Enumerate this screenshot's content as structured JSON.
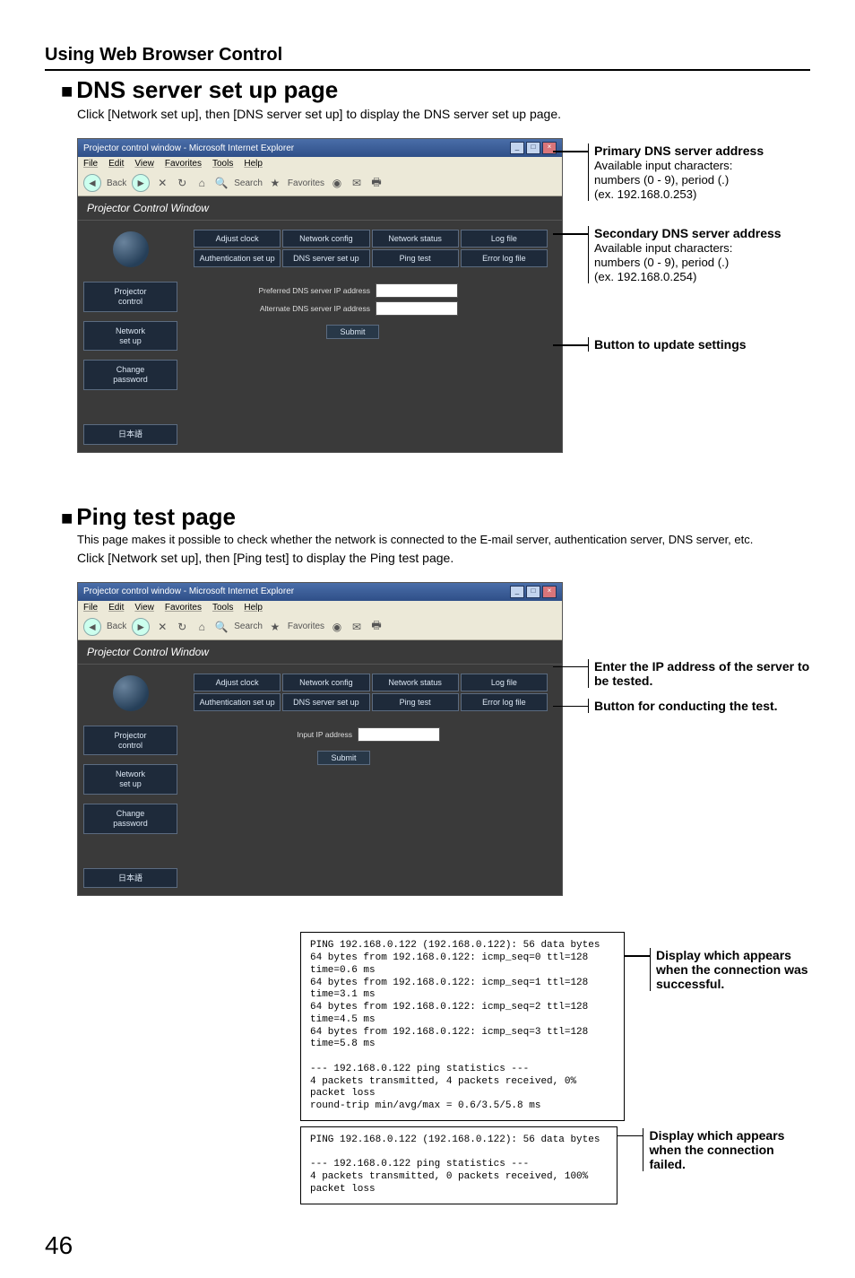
{
  "page_number": "46",
  "section_header": "Using Web Browser Control",
  "dns": {
    "heading_bullet": "■",
    "heading": "DNS server set up page",
    "desc": "Click [Network set up], then [DNS server set up] to display the DNS server set up page.",
    "browser_title": "Projector control window - Microsoft Internet Explorer",
    "menubar": {
      "file": "File",
      "edit": "Edit",
      "view": "View",
      "favorites": "Favorites",
      "tools": "Tools",
      "help": "Help"
    },
    "toolbar": {
      "back": "Back",
      "search": "Search",
      "favorites": "Favorites"
    },
    "pcw_title": "Projector Control Window",
    "sidebar_items": [
      "Projector\ncontrol",
      "Network\nset up",
      "Change\npassword",
      "日本語"
    ],
    "tabs_row1": [
      "Adjust clock",
      "Network config",
      "Network status",
      "Log file"
    ],
    "tabs_row2": [
      "Authentication set up",
      "DNS server set up",
      "Ping test",
      "Error log file"
    ],
    "form_labels": [
      "Preferred DNS server IP address",
      "Alternate DNS server IP address"
    ],
    "submit_label": "Submit",
    "callouts": [
      {
        "title": "Primary DNS server address",
        "lines": [
          "Available input characters:",
          "numbers (0 - 9), period (.)",
          "(ex. 192.168.0.253)"
        ]
      },
      {
        "title": "Secondary DNS server address",
        "lines": [
          "Available input characters:",
          "numbers (0 - 9), period (.)",
          "(ex. 192.168.0.254)"
        ]
      },
      {
        "title": "Button to update settings",
        "lines": []
      }
    ]
  },
  "ping": {
    "heading_bullet": "■",
    "heading": "Ping test page",
    "desc1": "This page makes it possible to check whether the network is connected to the E-mail server, authentication server, DNS server, etc.",
    "desc2": "Click [Network set up], then [Ping test] to display the Ping test page.",
    "form_label": "Input IP address",
    "submit_label": "Submit",
    "callouts": [
      {
        "title": "Enter the IP address of the server to be tested.",
        "lines": []
      },
      {
        "title": "Button for conducting the test.",
        "lines": []
      }
    ],
    "success_box": "PING 192.168.0.122 (192.168.0.122): 56 data bytes\n64 bytes from 192.168.0.122: icmp_seq=0 ttl=128 time=0.6 ms\n64 bytes from 192.168.0.122: icmp_seq=1 ttl=128 time=3.1 ms\n64 bytes from 192.168.0.122: icmp_seq=2 ttl=128 time=4.5 ms\n64 bytes from 192.168.0.122: icmp_seq=3 ttl=128 time=5.8 ms\n\n--- 192.168.0.122 ping statistics ---\n4 packets transmitted, 4 packets received, 0% packet loss\nround-trip min/avg/max = 0.6/3.5/5.8 ms",
    "fail_box": "PING 192.168.0.122 (192.168.0.122): 56 data bytes\n\n--- 192.168.0.122 ping statistics ---\n4 packets transmitted, 0 packets received, 100% packet loss",
    "success_callout": [
      "Display which appears",
      "when the connection was",
      "successful."
    ],
    "fail_callout": [
      "Display which appears",
      "when the connection failed."
    ]
  }
}
